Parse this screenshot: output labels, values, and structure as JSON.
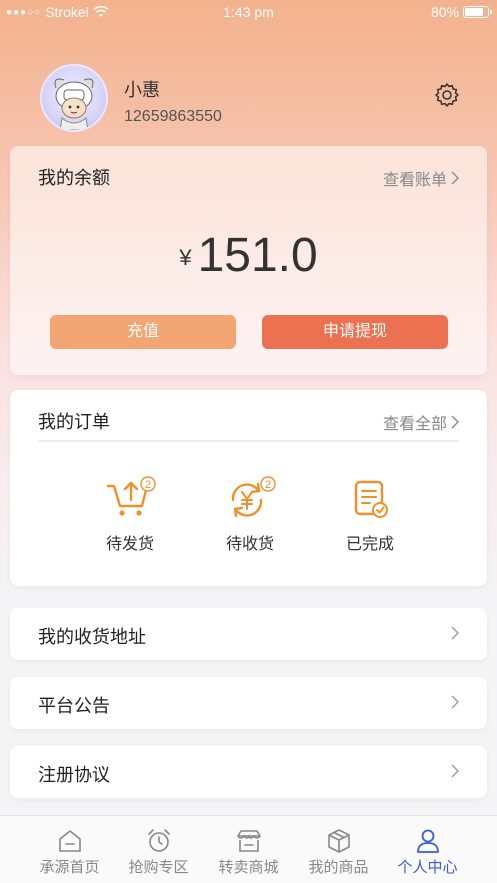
{
  "status_bar": {
    "carrier": "Strokel",
    "time": "1:43 pm",
    "battery": "80%",
    "signal_dots": "●●●○○"
  },
  "profile": {
    "name": "小惠",
    "phone": "12659863550"
  },
  "balance": {
    "title": "我的余额",
    "link": "查看账单",
    "currency": "¥",
    "amount": "151.0",
    "recharge_label": "充值",
    "withdraw_label": "申请提现"
  },
  "orders": {
    "title": "我的订单",
    "link": "查看全部",
    "items": [
      {
        "label": "待发货",
        "badge": "2",
        "icon": "cart-upload-icon"
      },
      {
        "label": "待收货",
        "badge": "2",
        "icon": "yen-cycle-icon"
      },
      {
        "label": "已完成",
        "badge": "",
        "icon": "completed-doc-icon"
      }
    ]
  },
  "menu": [
    {
      "label": "我的收货地址"
    },
    {
      "label": "平台公告"
    },
    {
      "label": "注册协议"
    }
  ],
  "tabbar": [
    {
      "label": "承源首页",
      "icon": "home-icon"
    },
    {
      "label": "抢购专区",
      "icon": "alarm-clock-icon"
    },
    {
      "label": "转卖商城",
      "icon": "store-icon"
    },
    {
      "label": "我的商品",
      "icon": "box-icon"
    },
    {
      "label": "个人中心",
      "icon": "person-icon",
      "active": true
    }
  ],
  "colors": {
    "accent_orange": "#f0902a",
    "recharge": "#f4a574",
    "withdraw": "#ec7150",
    "tab_active": "#3b5bd5"
  }
}
